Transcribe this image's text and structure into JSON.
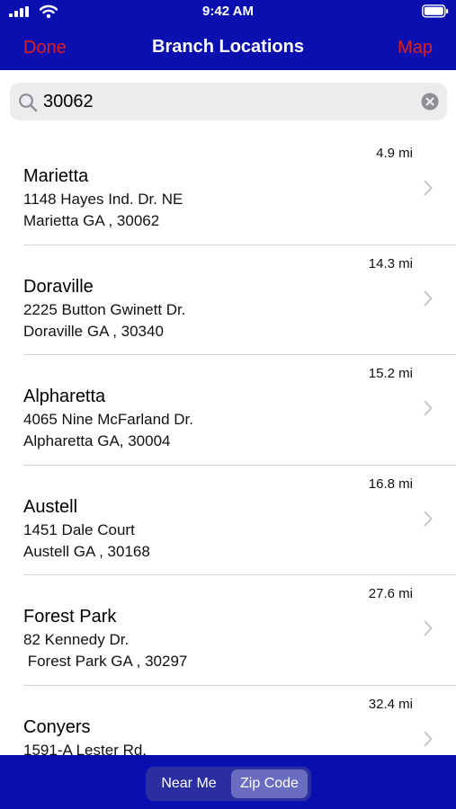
{
  "status_bar": {
    "time": "9:42 AM"
  },
  "nav": {
    "left_label": "Done",
    "title": "Branch Locations",
    "right_label": "Map"
  },
  "search": {
    "value": "30062",
    "placeholder": ""
  },
  "branches": [
    {
      "distance": "4.9 mi",
      "name": "Marietta",
      "address_line1": "1148 Hayes Ind. Dr. NE",
      "address_line2": "Marietta GA , 30062"
    },
    {
      "distance": "14.3 mi",
      "name": "Doraville",
      "address_line1": "2225 Button Gwinett Dr.",
      "address_line2": "Doraville GA , 30340"
    },
    {
      "distance": "15.2 mi",
      "name": "Alpharetta",
      "address_line1": "4065 Nine McFarland Dr.",
      "address_line2": "Alpharetta GA, 30004"
    },
    {
      "distance": "16.8 mi",
      "name": "Austell",
      "address_line1": "1451 Dale Court",
      "address_line2": "Austell GA , 30168"
    },
    {
      "distance": "27.6 mi",
      "name": "Forest Park",
      "address_line1": "82 Kennedy Dr.",
      "address_line2": " Forest Park GA , 30297"
    },
    {
      "distance": "32.4 mi",
      "name": "Conyers",
      "address_line1": "1591-A Lester Rd.",
      "address_line2": ""
    }
  ],
  "segmented_control": {
    "options": [
      "Near Me",
      "Zip Code"
    ],
    "selected": "Zip Code"
  },
  "colors": {
    "bar_background": "#0a0fb0",
    "accent_red": "#e0201c"
  }
}
